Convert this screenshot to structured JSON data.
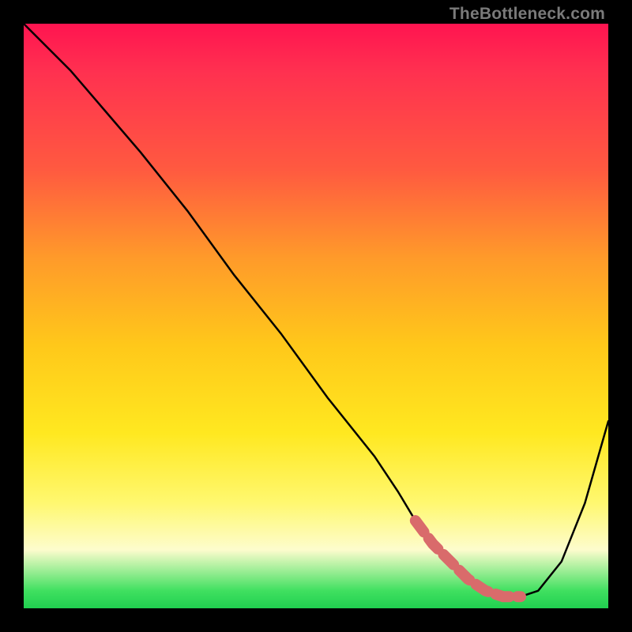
{
  "watermark": "TheBottleneck.com",
  "chart_data": {
    "type": "line",
    "title": "",
    "xlabel": "",
    "ylabel": "",
    "xlim": [
      0,
      100
    ],
    "ylim": [
      0,
      100
    ],
    "series": [
      {
        "name": "bottleneck-curve",
        "x": [
          0,
          8,
          14,
          20,
          28,
          36,
          44,
          52,
          60,
          64,
          67,
          70,
          73,
          76,
          79,
          82,
          85,
          88,
          92,
          96,
          100
        ],
        "values": [
          100,
          92,
          85,
          78,
          68,
          57,
          47,
          36,
          26,
          20,
          15,
          11,
          8,
          5,
          3,
          2,
          2,
          3,
          8,
          18,
          32
        ]
      }
    ],
    "highlight": {
      "name": "optimal-range",
      "x": [
        67,
        70,
        73,
        76,
        79,
        82,
        85
      ],
      "values": [
        15,
        11,
        8,
        5,
        3,
        2,
        2
      ]
    }
  }
}
